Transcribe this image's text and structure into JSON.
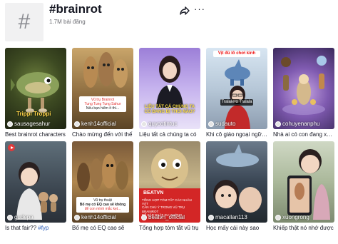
{
  "header": {
    "hash_symbol": "#",
    "title": "#brainrot",
    "post_count": "1.7M bài đăng",
    "share_icon": "share-arrow-icon",
    "more_label": "···"
  },
  "videos": [
    {
      "author": "sausagesahur",
      "caption": "Best brainrot characters",
      "overlay": "Trippi Troppi"
    },
    {
      "author": "kenh14official",
      "caption": "Chào mừng đến với thế",
      "overlay_lines": [
        "Vũ trụ Brainrot",
        "Tung Tung Tung Sahur",
        "Nếu bạn hiểm ít thì..."
      ]
    },
    {
      "author": "quycotintuc",
      "caption": "Liệu tất cả chúng ta có",
      "overlay": "LIỆU TẤT CẢ CHÚNG TA CÓ ĐANG BỊ THỐI NÃO?"
    },
    {
      "author": "sudauto",
      "caption": "Khi cô giáo ngoại ngữ lớp",
      "overlay_top": "Vịt đủ lô chơi kinh",
      "overlay": "Tralalero Tralala"
    },
    {
      "author": "cohuyenanphu",
      "caption": "Nhà ai có con đang xem",
      "overlay": ""
    },
    {
      "author": "gudepa",
      "caption": "Is that fair?? #fyp",
      "caption_main": "Is that fair?? ",
      "caption_tag": "#fyp"
    },
    {
      "author": "kenh14official",
      "caption": "Bố mẹ có EQ cao sẽ",
      "overlay_lines": [
        "Vũ trụ thuật",
        "Bố mẹ có EQ cao sẽ không",
        "để con mình mắc kẹt..."
      ]
    },
    {
      "author": "beatvn_official",
      "caption": "Tổng hợp tóm tắt vũ trụ",
      "overlay_title": "BEATVN",
      "overlay_lines": [
        "TỔNG HỢP TÓM TẮT CÁC NHÂN VẬT",
        "CẦN CHÚ Ý TRONG VŨ TRỤ BRAINROT",
        "ĐỂ CẬP NHẬT XU HƯỚNG"
      ]
    },
    {
      "author": "macallan113",
      "caption": "Học mấy cái này sao",
      "overlay": ""
    },
    {
      "author": "xuongrong",
      "caption": "Khiếp thật nó nhớ được",
      "overlay": ""
    }
  ]
}
